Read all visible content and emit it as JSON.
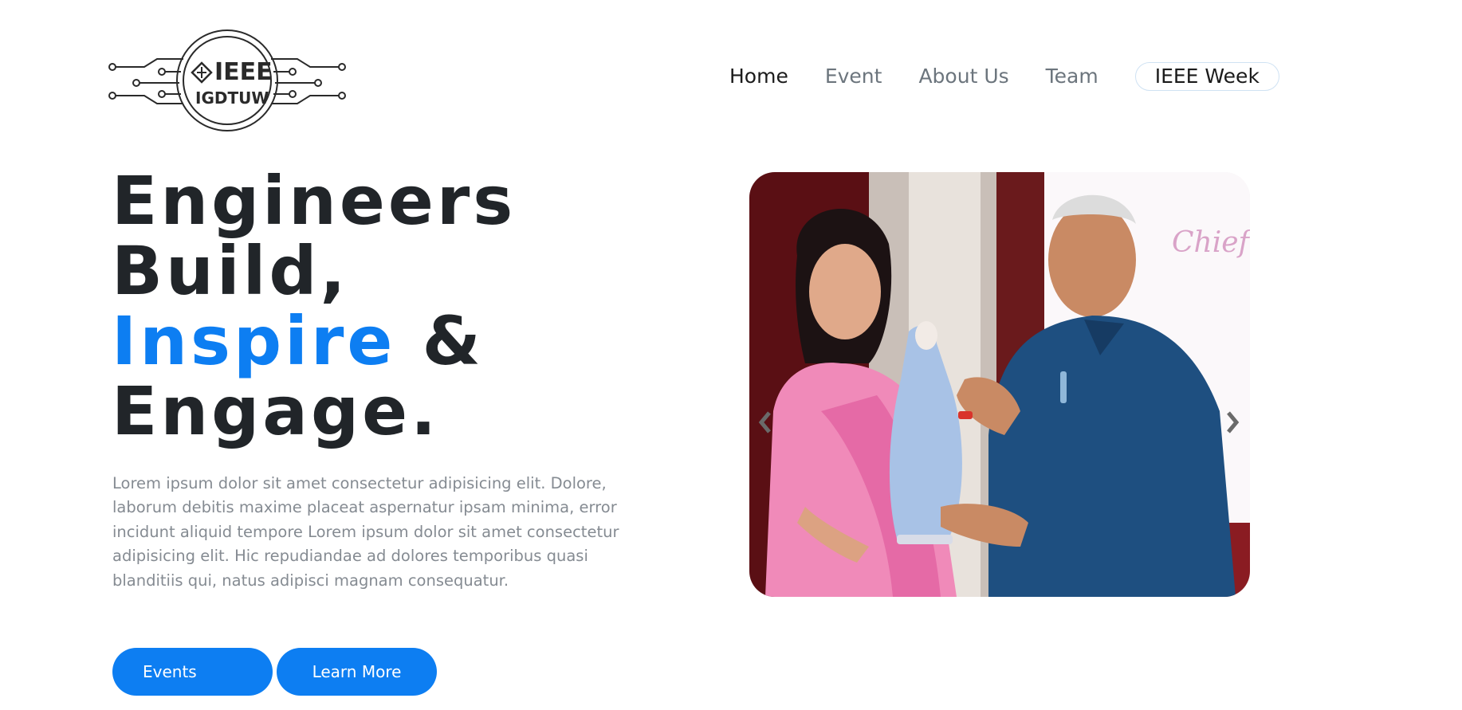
{
  "logo": {
    "title": "IEEE",
    "subtitle": "IGDTUW"
  },
  "nav": {
    "items": [
      {
        "label": "Home",
        "active": true
      },
      {
        "label": "Event",
        "active": false
      },
      {
        "label": "About Us",
        "active": false
      },
      {
        "label": "Team",
        "active": false
      }
    ],
    "highlight": {
      "label": "IEEE Week"
    }
  },
  "hero": {
    "title_line1": "Engineers",
    "title_line2": "Build,",
    "title_accent": "Inspire",
    "title_amp": " &",
    "title_line4": "Engage.",
    "description": "Lorem ipsum dolor sit amet consectetur adipisicing elit. Dolore, laborum debitis maxime placeat aspernatur ipsam minima, error incidunt aliquid tempore Lorem ipsum dolor sit amet consectetur adipisicing elit. Hic repudiandae ad dolores temporibus quasi blanditiis qui, natus adipisci magnam consequatur.",
    "buttons": {
      "events": "Events",
      "learn_more": "Learn More"
    }
  },
  "carousel": {
    "banner_text": "Chief G",
    "prev_icon": "chevron-left-icon",
    "next_icon": "chevron-right-icon"
  },
  "colors": {
    "accent": "#0d7ef2",
    "heading": "#212529",
    "muted": "#858b92",
    "nav_inactive": "#6c757d"
  }
}
